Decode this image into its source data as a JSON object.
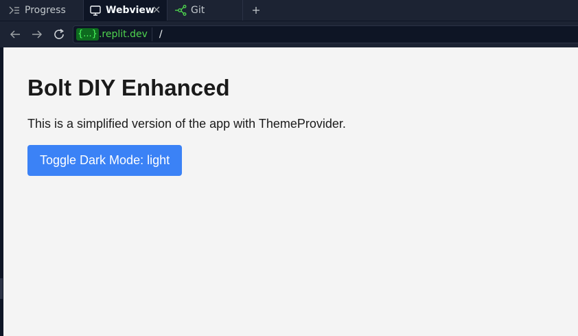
{
  "tabs": [
    {
      "label": "Progress",
      "icon": "progress-icon",
      "active": false
    },
    {
      "label": "Webview",
      "icon": "monitor-icon",
      "active": true
    },
    {
      "label": "Git",
      "icon": "git-icon",
      "active": false
    }
  ],
  "url": {
    "host_badge": "{...}",
    "host_rest": ".replit.dev",
    "path": "/"
  },
  "page": {
    "title": "Bolt DIY Enhanced",
    "description": "This is a simplified version of the app with ThemeProvider.",
    "toggle_label": "Toggle Dark Mode: light"
  },
  "colors": {
    "tabbar_bg": "#1c2333",
    "page_bg": "#f4f4f4",
    "button_bg": "#3b82f6",
    "host_green": "#4fd54f"
  }
}
